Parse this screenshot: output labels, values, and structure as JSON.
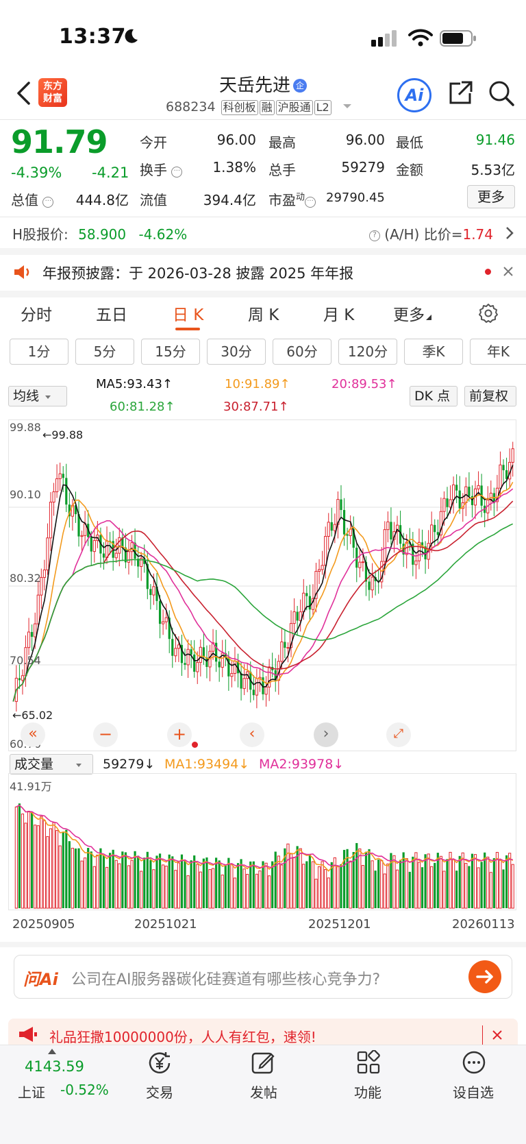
{
  "status": {
    "time": "13:37"
  },
  "header": {
    "logo_line1": "东方",
    "logo_line2": "财富",
    "stock_name": "天岳先进",
    "qi_badge": "企",
    "code": "688234",
    "tags": [
      "科创板",
      "融",
      "沪股通",
      "L2"
    ],
    "ai_label": "Ai"
  },
  "quote": {
    "price": "91.79",
    "change_pct": "-4.39%",
    "change": "-4.21",
    "fields": [
      {
        "label": "今开",
        "value": "96.00"
      },
      {
        "label": "最高",
        "value": "96.00"
      },
      {
        "label": "最低",
        "value": "91.46"
      },
      {
        "label": "换手",
        "value": "1.38%"
      },
      {
        "label": "总手",
        "value": "59279"
      },
      {
        "label": "金额",
        "value": "5.53亿"
      },
      {
        "label": "总值",
        "value": "444.8亿"
      },
      {
        "label": "流值",
        "value": "394.4亿"
      },
      {
        "label": "市盈",
        "sup": "动",
        "value": "29790.45"
      }
    ],
    "more_label": "更多"
  },
  "hshare": {
    "label": "H股报价:",
    "price": "58.900",
    "pct": "-4.62%",
    "ah_label": "(A/H) 比价=",
    "ah_value": "1.74"
  },
  "notice": {
    "text": "年报预披露：于 2026-03-28 披露 2025 年年报"
  },
  "tabs": [
    "分时",
    "五日",
    "日 K",
    "周 K",
    "月 K",
    "更多"
  ],
  "periods": [
    "1分",
    "5分",
    "15分",
    "30分",
    "60分",
    "120分",
    "季K",
    "年K"
  ],
  "ma": {
    "select": "均线",
    "ma5": "MA5:93.43",
    "ma10": "10:91.89",
    "ma20": "20:89.53",
    "ma60": "60:81.28",
    "ma30": "30:87.71",
    "dk_label": "DK 点",
    "fuquan_label": "前复权"
  },
  "chart": {
    "y_top": "99.88",
    "y_90": "90.10",
    "y_80": "80.32",
    "y_70": "70.54",
    "y_bottom": "60.76",
    "max_label": "←99.88",
    "min_label": "←65.02"
  },
  "volume": {
    "select": "成交量",
    "value": "59279",
    "ma1": "MA1:93494",
    "ma2": "MA2:93978",
    "top_label": "41.91万",
    "dates": [
      "20250905",
      "20251021",
      "20251201",
      "20260113"
    ]
  },
  "ask": {
    "brand": "问Ai",
    "text": "公司在AI服务器碳化硅赛道有哪些核心竞争力?"
  },
  "promo": {
    "text": "礼品狂撒10000000份，人人有红包，速领!"
  },
  "nav": {
    "index_value": "4143.59",
    "index_name": "上证",
    "index_pct": "-0.52%",
    "items": [
      "交易",
      "发帖",
      "功能",
      "设自选"
    ]
  },
  "colors": {
    "up": "#e0232b",
    "down": "#0a9c2a",
    "accent": "#e8541c",
    "ma5": "#111111",
    "ma10": "#f39a1d",
    "ma20": "#e0309a",
    "ma30": "#c8202e",
    "ma60": "#2aa53a"
  }
}
